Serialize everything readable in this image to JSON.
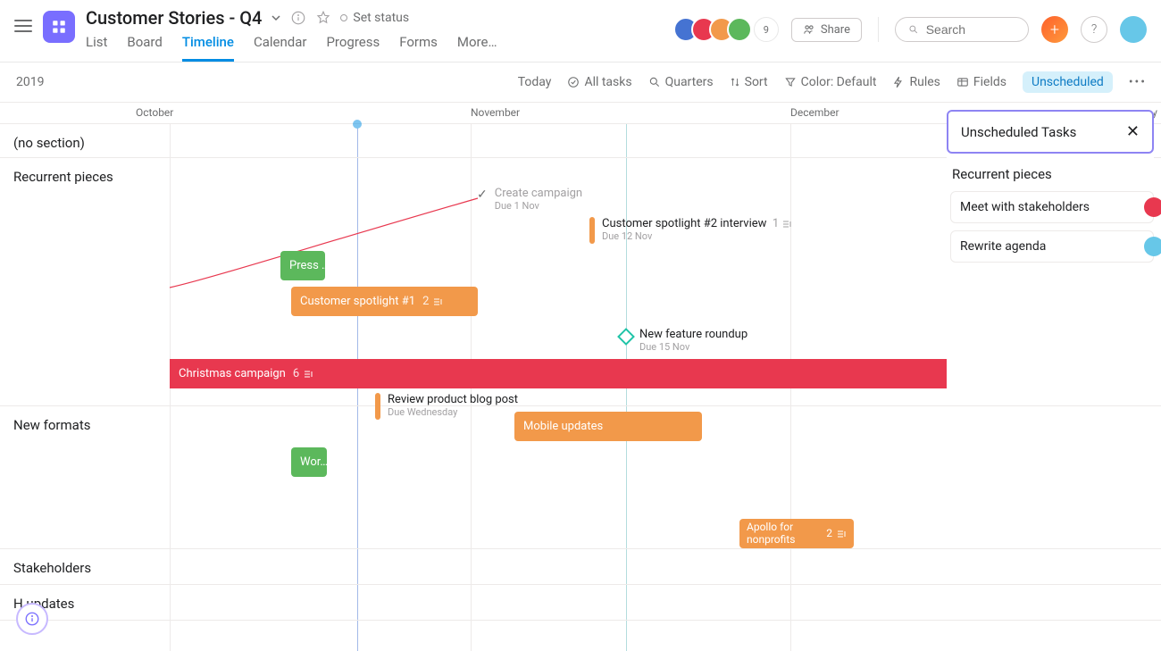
{
  "project": {
    "title": "Customer Stories - Q4"
  },
  "tabs": {
    "list": "List",
    "board": "Board",
    "timeline": "Timeline",
    "calendar": "Calendar",
    "progress": "Progress",
    "forms": "Forms",
    "more": "More…"
  },
  "set_status": "Set status",
  "share": "Share",
  "search_placeholder": "Search",
  "avatar_overflow": "9",
  "toolbar": {
    "year": "2019",
    "today": "Today",
    "all_tasks": "All tasks",
    "quarters": "Quarters",
    "sort": "Sort",
    "color": "Color: Default",
    "rules": "Rules",
    "fields": "Fields",
    "unscheduled": "Unscheduled"
  },
  "months": {
    "oct": "October",
    "nov": "November",
    "dec": "December",
    "jan": "January"
  },
  "sections": {
    "none": "(no section)",
    "recurrent": "Recurrent pieces",
    "newformats": "New formats",
    "stakeholders": "Stakeholders",
    "updates": "H        updates"
  },
  "tasks": {
    "press": "Press …",
    "spotlight1": "Customer spotlight #1",
    "spotlight1_count": "2",
    "christmas": "Christmas campaign",
    "christmas_count": "6",
    "mobile": "Mobile updates",
    "work": "Wor…",
    "apollo": "Apollo for nonprofits",
    "apollo_count": "2"
  },
  "milestones": {
    "create_campaign": {
      "title": "Create campaign",
      "sub": "Due 1 Nov"
    },
    "spotlight2": {
      "title": "Customer spotlight #2 interview",
      "count": "1",
      "sub": "Due 12 Nov"
    },
    "feature_roundup": {
      "title": "New feature roundup",
      "sub": "Due 15 Nov"
    },
    "review_blog": {
      "title": "Review product blog post",
      "sub": "Due Wednesday"
    }
  },
  "panel": {
    "title": "Unscheduled Tasks",
    "section": "Recurrent pieces",
    "card1": "Meet with stakeholders",
    "card2": "Rewrite agenda"
  },
  "avatar_colors": [
    "#4573d2",
    "#e8384f",
    "#f2994a",
    "#5cb85c"
  ]
}
